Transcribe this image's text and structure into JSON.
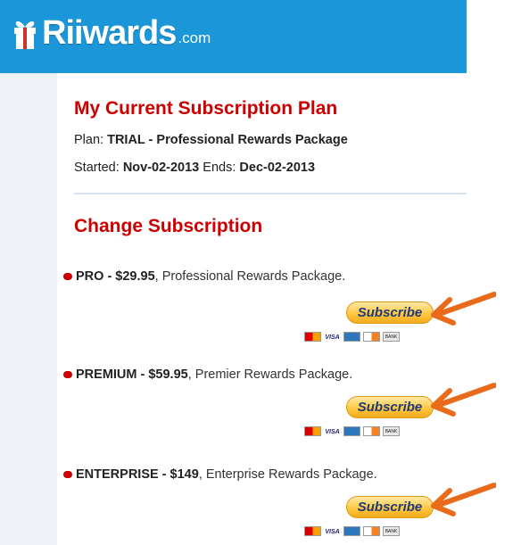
{
  "brand": {
    "name": "Riiwards",
    "domain_suffix": ".com"
  },
  "current": {
    "title": "My Current Subscription Plan",
    "plan_label": "Plan:",
    "plan_value": "TRIAL - Professional Rewards Package",
    "started_label": "Started:",
    "started_value": "Nov-02-2013",
    "ends_label": "Ends:",
    "ends_value": "Dec-02-2013"
  },
  "change": {
    "title": "Change Subscription",
    "subscribe_label": "Subscribe",
    "cards": [
      "mastercard-icon",
      "visa-icon",
      "amex-icon",
      "discover-icon",
      "bank-icon"
    ],
    "plans": [
      {
        "name_price": "PRO - $29.95",
        "description": ", Professional Rewards Package."
      },
      {
        "name_price": "PREMIUM - $59.95",
        "description": ", Premier Rewards Package."
      },
      {
        "name_price": "ENTERPRISE - $149",
        "description": ", Enterprise Rewards Package."
      }
    ]
  },
  "colors": {
    "header_blue": "#1a96d9",
    "heading_red": "#cc0000",
    "arrow_orange": "#e86a1a",
    "button_gold": "#ffc843"
  }
}
